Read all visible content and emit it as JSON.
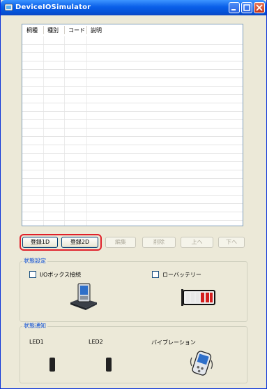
{
  "window": {
    "title": "DeviceIOSimulator"
  },
  "list": {
    "columns": [
      "桐種",
      "種別",
      "コード",
      "説明"
    ],
    "rows": 25
  },
  "buttons": {
    "register1d": "登録1D",
    "register2d": "登録2D",
    "edit": "編集",
    "delete": "削除",
    "up": "上へ",
    "down": "下へ"
  },
  "status_settings": {
    "label": "状態設定",
    "io_box": "I/Oボックス接続",
    "low_battery": "ローバッテリー"
  },
  "status_notify": {
    "label": "状態通知",
    "led1": "LED1",
    "led2": "LED2",
    "vibration": "バイブレーション"
  },
  "colors": {
    "title_bar": "#0a5fe9",
    "highlight": "#e0202a",
    "group_label": "#0046d5"
  }
}
